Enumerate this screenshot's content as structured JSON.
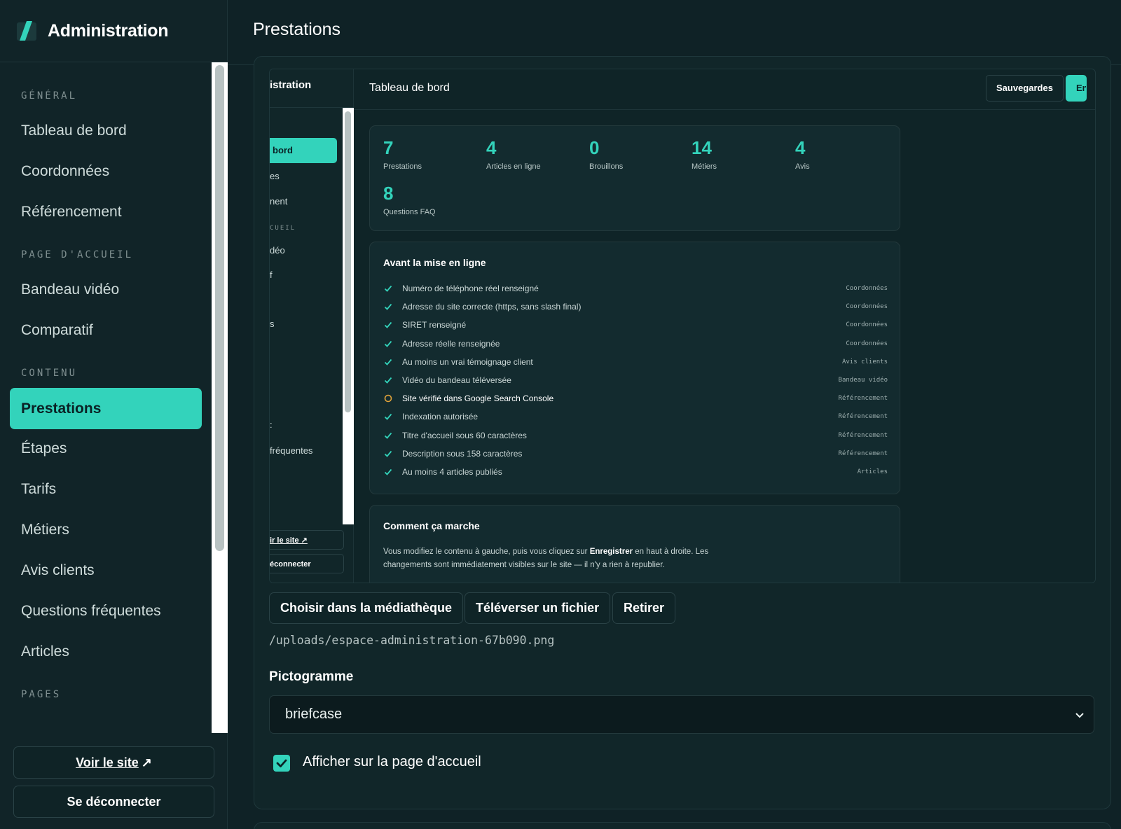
{
  "app": {
    "title": "Administration"
  },
  "page": {
    "title": "Prestations"
  },
  "sidebar": {
    "sections": [
      {
        "label": "GÉNÉRAL"
      },
      {
        "label": "PAGE D'ACCUEIL"
      },
      {
        "label": "CONTENU"
      },
      {
        "label": "PAGES"
      }
    ],
    "items": [
      {
        "label": "Tableau de bord"
      },
      {
        "label": "Coordonnées"
      },
      {
        "label": "Référencement"
      },
      {
        "label": "Bandeau vidéo"
      },
      {
        "label": "Comparatif"
      },
      {
        "label": "Prestations"
      },
      {
        "label": "Étapes"
      },
      {
        "label": "Tarifs"
      },
      {
        "label": "Métiers"
      },
      {
        "label": "Avis clients"
      },
      {
        "label": "Questions fréquentes"
      },
      {
        "label": "Articles"
      }
    ],
    "active_item": "Prestations",
    "view_site": "Voir le site",
    "view_site_arrow": "↗",
    "logout": "Se déconnecter"
  },
  "preview": {
    "brand": "istration",
    "title": "Tableau de bord",
    "nav": {
      "active": "bord",
      "item_1": "es",
      "item_2": "nent",
      "section": "CUEIL",
      "item_3": "déo",
      "item_4": "f",
      "item_5": "s",
      "item_6": ":",
      "item_7": "fréquentes"
    },
    "view_site": "ir le site ↗",
    "logout": "éconnecter",
    "buttons": {
      "backups": "Sauvegardes",
      "save": "En"
    },
    "stats": [
      {
        "value": "7",
        "label": "Prestations"
      },
      {
        "value": "4",
        "label": "Articles en ligne"
      },
      {
        "value": "0",
        "label": "Brouillons"
      },
      {
        "value": "14",
        "label": "Métiers"
      },
      {
        "value": "4",
        "label": "Avis"
      },
      {
        "value": "8",
        "label": "Questions FAQ"
      }
    ],
    "checklist_title": "Avant la mise en ligne",
    "checklist": [
      {
        "text": "Numéro de téléphone réel renseigné",
        "tag": "Coordonnées",
        "status": "done"
      },
      {
        "text": "Adresse du site correcte (https, sans slash final)",
        "tag": "Coordonnées",
        "status": "done"
      },
      {
        "text": "SIRET renseigné",
        "tag": "Coordonnées",
        "status": "done"
      },
      {
        "text": "Adresse réelle renseignée",
        "tag": "Coordonnées",
        "status": "done"
      },
      {
        "text": "Au moins un vrai témoignage client",
        "tag": "Avis clients",
        "status": "done"
      },
      {
        "text": "Vidéo du bandeau téléversée",
        "tag": "Bandeau vidéo",
        "status": "done"
      },
      {
        "text": "Site vérifié dans Google Search Console",
        "tag": "Référencement",
        "status": "pending"
      },
      {
        "text": "Indexation autorisée",
        "tag": "Référencement",
        "status": "done"
      },
      {
        "text": "Titre d'accueil sous 60 caractères",
        "tag": "Référencement",
        "status": "done"
      },
      {
        "text": "Description sous 158 caractères",
        "tag": "Référencement",
        "status": "done"
      },
      {
        "text": "Au moins 4 articles publiés",
        "tag": "Articles",
        "status": "done"
      }
    ],
    "how_title": "Comment ça marche",
    "how_text_1": "Vous modifiez le contenu à gauche, puis vous cliquez sur ",
    "how_text_bold": "Enregistrer",
    "how_text_2": " en haut à droite. Les changements sont immédiatement visibles sur le site — il n'y a rien à republier."
  },
  "actions": {
    "choose_media": "Choisir dans la médiathèque",
    "upload": "Téléverser un fichier",
    "remove": "Retirer"
  },
  "file_path": "/uploads/espace-administration-67b090.png",
  "pictogram": {
    "label": "Pictogramme",
    "value": "briefcase"
  },
  "show_homepage": {
    "label": "Afficher sur la page d'accueil",
    "checked": true
  },
  "colors": {
    "accent": "#33d3bb",
    "background": "#0f2226",
    "pending": "#e0a23a"
  },
  "icons": [
    "logo-slash-icon",
    "external-link-icon",
    "check-icon",
    "pending-circle-icon",
    "chevron-down-icon",
    "checkbox-checked-icon"
  ]
}
